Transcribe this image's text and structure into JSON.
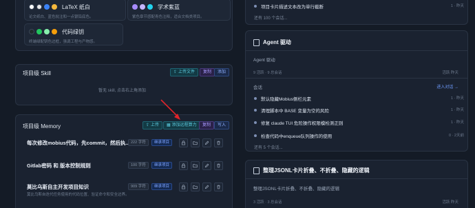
{
  "themes": {
    "latex": {
      "name": "LaTeX 纸白",
      "desc": "论文纸白、蓝色批注和一点银铅底色。",
      "colors": [
        "#ffffff",
        "#e8e8e8",
        "#3b82f6",
        "#f5b83d"
      ]
    },
    "academic": {
      "name": "学术紫蓝",
      "desc": "紫色章节感配青色注释，适合文档类项目。",
      "colors": [
        "#a78bfa",
        "#c4b5fd",
        "#22d3ee"
      ]
    },
    "code_green": {
      "name": "代码绿钥",
      "desc": "终端绿配钥色边框，强调工程与产物感。",
      "colors": [
        "#1f2a2a",
        "#22c55e",
        "#86efac",
        "#f59e0b"
      ]
    }
  },
  "skill": {
    "title": "项目级 Skill",
    "upload_label": "上传文件",
    "copy_label": "复制",
    "add_label": "添加",
    "empty_text": "暂无 skill, 点击右上角添加"
  },
  "memory": {
    "title": "项目级 Memory",
    "upload_label": "上传",
    "add_remote_label": "添加远程算力",
    "copy_label": "复制",
    "write_label": "写入",
    "items": [
      {
        "title": "每次修改mobius代码，先commit，然后执...",
        "sub": "",
        "size": "222 字符",
        "tag": "继承项目"
      },
      {
        "title": "Gitlab密码 和 版本控制规则",
        "sub": "",
        "size": "100 字符",
        "tag": "继承项目"
      },
      {
        "title": "莫比乌斯自主开发项目知识",
        "sub": "莫比乌斯自迭代任务使用的代码位置、验证命令和安全边界。",
        "size": "909 字符",
        "tag": "继承项目"
      }
    ]
  },
  "history": {
    "item_title": "项目卡片描述文本改为单行截断",
    "item_time": "1 · 昨天",
    "more": "还有 100 个会话..."
  },
  "agent": {
    "title": "Agent 驱动",
    "desc": "Agent 驱动",
    "meta": "9 活跃 · 9 总会话",
    "meta_right": "活跃 昨天",
    "sessions_label": "会话",
    "enter_label": "进入对话 →",
    "sessions": [
      {
        "title": "默认隐藏Mobius侧栏元素",
        "time": "1 · 昨天"
      },
      {
        "title": "清理脚本中 BASE 变量为空的风险",
        "time": "1 · 昨天"
      },
      {
        "title": "修复 claude TUI 危险操作权限模检测正则",
        "time": "1 · 昨天"
      },
      {
        "title": "检查代码中enqueue队列操作的使用",
        "time": "0 · 2天前"
      }
    ],
    "more": "还有 5 个会话..."
  },
  "json_card": {
    "title": "整理JSONL卡片折叠、不折叠、隐藏的逻辑",
    "desc": "整理JSONL卡片折叠、不折叠、隐藏的逻辑",
    "meta": "3 活跃 · 3 总会话",
    "meta_right": "活跃 昨天"
  }
}
